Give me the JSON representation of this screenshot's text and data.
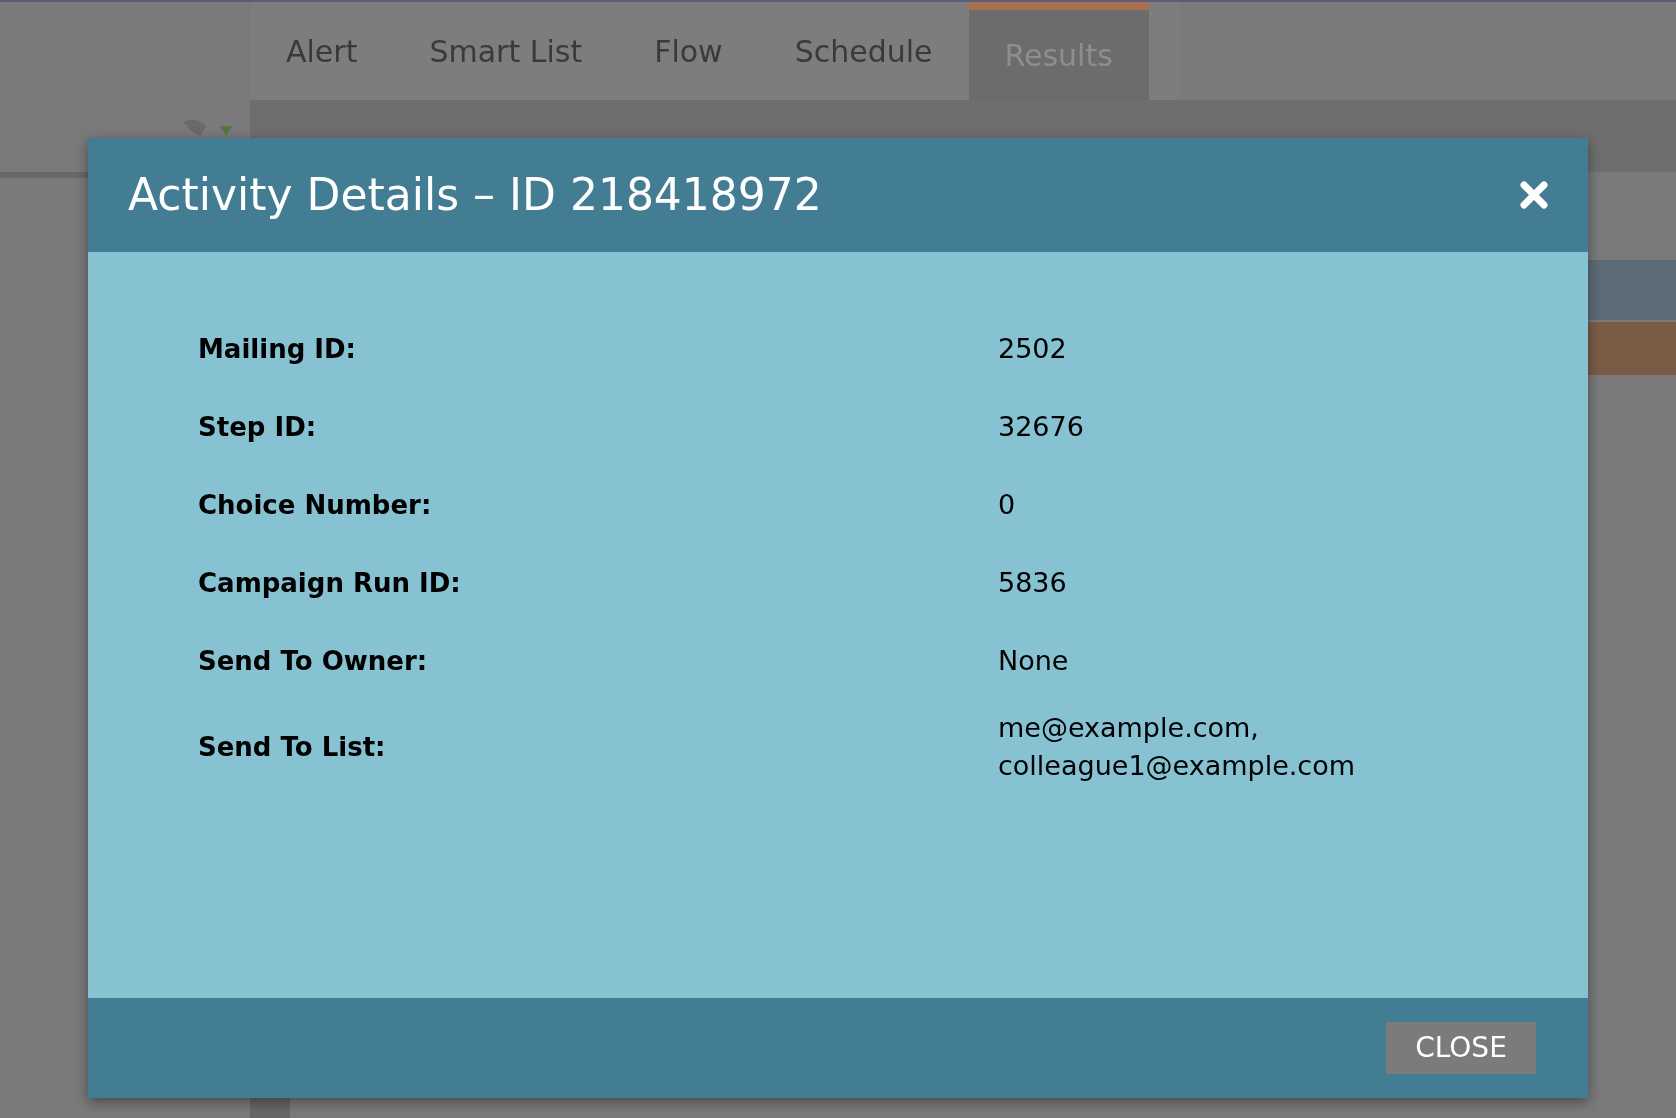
{
  "tabs": [
    {
      "label": "Alert",
      "selected": false
    },
    {
      "label": "Smart List",
      "selected": false
    },
    {
      "label": "Flow",
      "selected": false
    },
    {
      "label": "Schedule",
      "selected": false
    },
    {
      "label": "Results",
      "selected": true
    }
  ],
  "dialog": {
    "title": "Activity Details – ID 218418972",
    "fields": [
      {
        "label": "Mailing ID:",
        "value": [
          "2502"
        ]
      },
      {
        "label": "Step ID:",
        "value": [
          "32676"
        ]
      },
      {
        "label": "Choice Number:",
        "value": [
          "0"
        ]
      },
      {
        "label": "Campaign Run ID:",
        "value": [
          "5836"
        ]
      },
      {
        "label": "Send To Owner:",
        "value": [
          "None"
        ]
      },
      {
        "label": "Send To List:",
        "value": [
          "me@example.com,",
          "colleague1@example.com"
        ]
      }
    ],
    "close_button": "CLOSE"
  }
}
